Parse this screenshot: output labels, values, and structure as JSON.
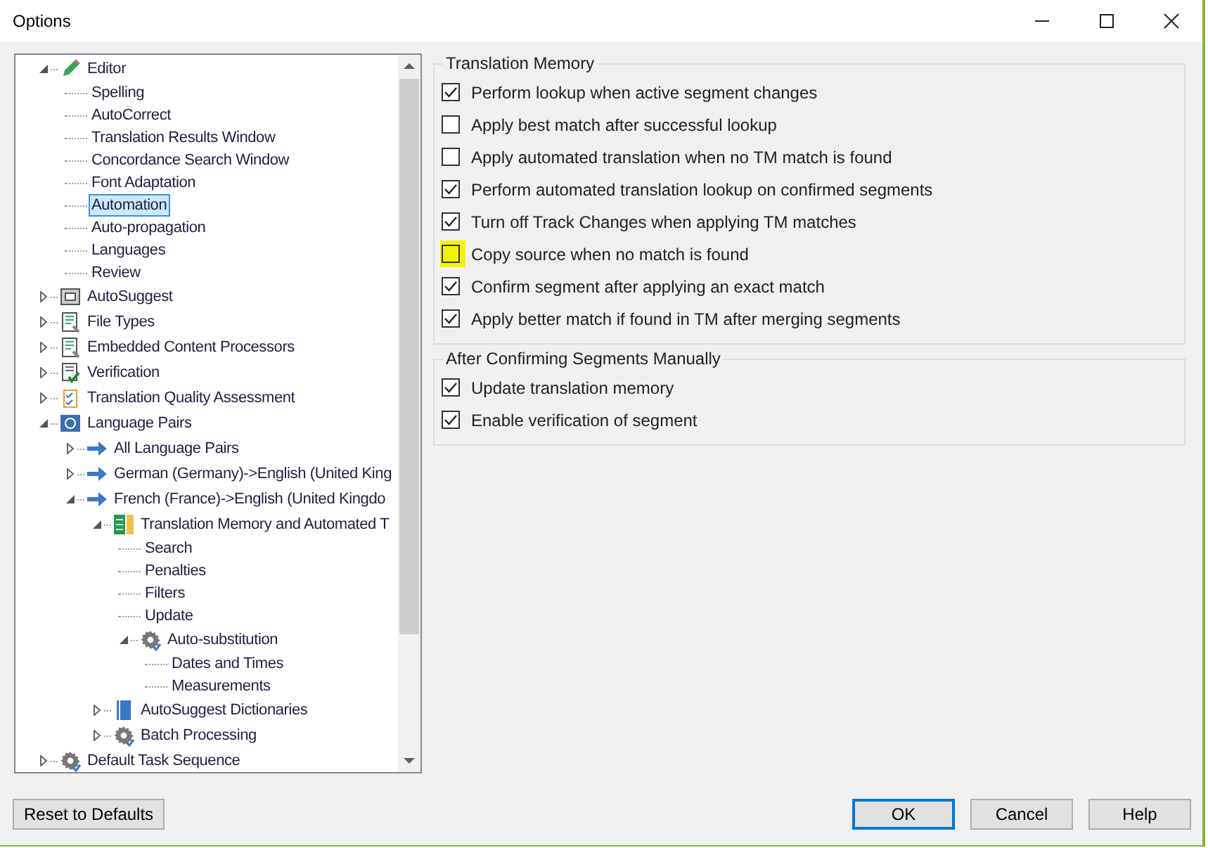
{
  "window": {
    "title": "Options"
  },
  "tree": [
    {
      "label": "Editor",
      "kind": "pencil",
      "expanded": true,
      "selected": false,
      "children": [
        {
          "label": "Spelling",
          "selected": false
        },
        {
          "label": "AutoCorrect",
          "selected": false
        },
        {
          "label": "Translation Results Window",
          "selected": false
        },
        {
          "label": "Concordance Search Window",
          "selected": false
        },
        {
          "label": "Font Adaptation",
          "selected": false
        },
        {
          "label": "Automation",
          "selected": true
        },
        {
          "label": "Auto-propagation",
          "selected": false
        },
        {
          "label": "Languages",
          "selected": false
        },
        {
          "label": "Review",
          "selected": false
        }
      ]
    },
    {
      "label": "AutoSuggest",
      "kind": "autosuggest",
      "expanded": false,
      "selected": false
    },
    {
      "label": "File Types",
      "kind": "document",
      "expanded": false,
      "selected": false
    },
    {
      "label": "Embedded Content Processors",
      "kind": "document",
      "expanded": false,
      "selected": false
    },
    {
      "label": "Verification",
      "kind": "verify",
      "expanded": false,
      "selected": false
    },
    {
      "label": "Translation Quality Assessment",
      "kind": "clipboard",
      "expanded": false,
      "selected": false
    },
    {
      "label": "Language Pairs",
      "kind": "langpairs",
      "expanded": true,
      "selected": false,
      "children": [
        {
          "label": "All Language Pairs",
          "kind": "arrow",
          "expanded": false,
          "selected": false
        },
        {
          "label": "German (Germany)->English (United King",
          "kind": "arrow",
          "expanded": false,
          "selected": false
        },
        {
          "label": "French (France)->English (United Kingdo",
          "kind": "arrow",
          "expanded": true,
          "selected": false,
          "children": [
            {
              "label": "Translation Memory and Automated T",
              "kind": "tm",
              "expanded": true,
              "selected": false,
              "children": [
                {
                  "label": "Search",
                  "selected": false
                },
                {
                  "label": "Penalties",
                  "selected": false
                },
                {
                  "label": "Filters",
                  "selected": false
                },
                {
                  "label": "Update",
                  "selected": false
                },
                {
                  "label": "Auto-substitution",
                  "kind": "gear",
                  "expanded": true,
                  "selected": false,
                  "children": [
                    {
                      "label": "Dates and Times",
                      "selected": false
                    },
                    {
                      "label": "Measurements",
                      "selected": false
                    }
                  ]
                }
              ]
            },
            {
              "label": "AutoSuggest Dictionaries",
              "kind": "book",
              "expanded": false,
              "selected": false
            },
            {
              "label": "Batch Processing",
              "kind": "gear",
              "expanded": false,
              "selected": false
            }
          ]
        }
      ]
    },
    {
      "label": "Default Task Sequence",
      "kind": "gear",
      "expanded": false,
      "selected": false
    }
  ],
  "groups": [
    {
      "title": "Translation Memory",
      "options": [
        {
          "label": "Perform lookup when active segment changes",
          "checked": true
        },
        {
          "label": "Apply best match after successful lookup",
          "checked": false
        },
        {
          "label": "Apply automated translation when no TM match is found",
          "checked": false
        },
        {
          "label": "Perform automated translation lookup on confirmed segments",
          "checked": true
        },
        {
          "label": "Turn off Track Changes when applying TM matches",
          "checked": true
        },
        {
          "label": "Copy source when no match is found",
          "checked": false,
          "highlighted": true
        },
        {
          "label": "Confirm segment after applying an exact match",
          "checked": true
        },
        {
          "label": "Apply better match if found in TM after merging segments",
          "checked": true
        }
      ]
    },
    {
      "title": "After Confirming Segments Manually",
      "options": [
        {
          "label": "Update translation memory",
          "checked": true
        },
        {
          "label": "Enable verification of segment",
          "checked": true
        }
      ]
    }
  ],
  "buttons": [
    {
      "label": "Reset to Defaults",
      "kind": "secondary"
    },
    {
      "label": "OK",
      "kind": "default"
    },
    {
      "label": "Cancel",
      "kind": "normal"
    },
    {
      "label": "Help",
      "kind": "normal"
    }
  ]
}
